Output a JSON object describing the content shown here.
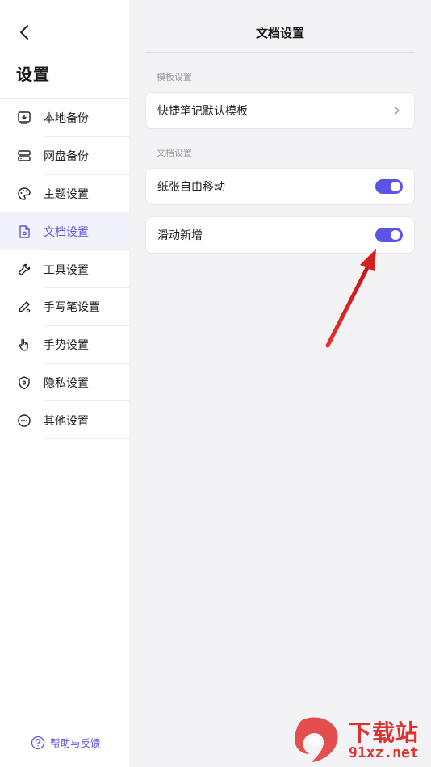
{
  "sidebar": {
    "title": "设置",
    "items": [
      {
        "label": "本地备份",
        "icon": "local-backup-icon"
      },
      {
        "label": "网盘备份",
        "icon": "cloud-backup-icon"
      },
      {
        "label": "主题设置",
        "icon": "palette-icon"
      },
      {
        "label": "文档设置",
        "icon": "document-settings-icon",
        "active": true
      },
      {
        "label": "工具设置",
        "icon": "wrench-icon"
      },
      {
        "label": "手写笔设置",
        "icon": "pen-icon"
      },
      {
        "label": "手势设置",
        "icon": "hand-gesture-icon"
      },
      {
        "label": "隐私设置",
        "icon": "shield-icon"
      },
      {
        "label": "其他设置",
        "icon": "more-icon"
      }
    ],
    "help_label": "帮助与反馈"
  },
  "main": {
    "title": "文档设置",
    "template_section": {
      "label": "模板设置",
      "quick_note_template_label": "快捷笔记默认模板"
    },
    "document_section": {
      "label": "文档设置",
      "paper_free_move": {
        "label": "纸张自由移动",
        "enabled": true
      },
      "swipe_add": {
        "label": "滑动新增",
        "enabled": true
      }
    }
  },
  "watermark": {
    "top": "下载站",
    "bottom": "91xz.net"
  },
  "colors": {
    "accent": "#5b55e6",
    "annotation_arrow": "#d42020"
  }
}
